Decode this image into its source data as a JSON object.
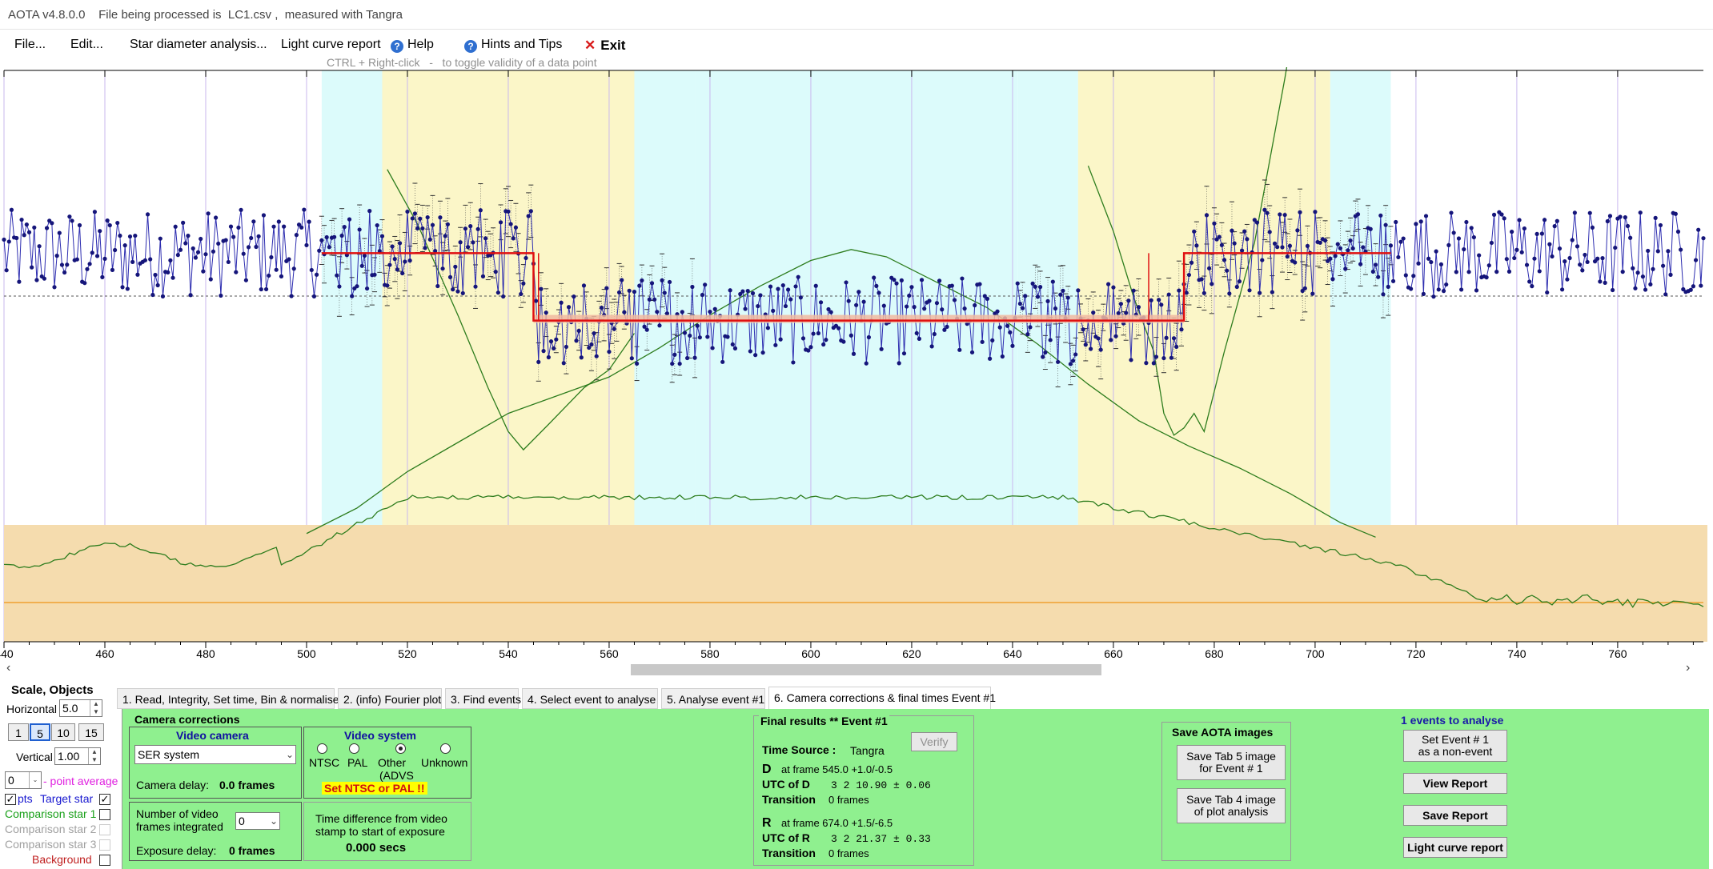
{
  "window": {
    "title": "AOTA v4.8.0.0    File being processed is  LC1.csv ,  measured with Tangra"
  },
  "menu": {
    "file": "File...",
    "edit": "Edit...",
    "star_diameter": "Star diameter analysis...",
    "light_curve_report": "Light curve report",
    "help": "Help",
    "hints": "Hints and Tips",
    "exit": "Exit"
  },
  "hint": "CTRL + Right-click   -   to toggle validity of a data point",
  "chart_data": {
    "type": "scatter",
    "x_ticks": [
      "440",
      "460",
      "480",
      "500",
      "520",
      "540",
      "560",
      "580",
      "600",
      "620",
      "640",
      "660",
      "680",
      "700",
      "720",
      "740",
      "760"
    ],
    "xlim": [
      440,
      777
    ],
    "ylim": [
      0,
      1
    ],
    "baseline_level": 0.72,
    "event_level": 0.535,
    "event_d_frame": 545.0,
    "event_r_frame": 674.0,
    "shaded_regions": [
      {
        "from": 503,
        "to": 515,
        "color": "#dcfbfb"
      },
      {
        "from": 515,
        "to": 565,
        "color": "#fbf6c8"
      },
      {
        "from": 565,
        "to": 577,
        "color": "#dcfbfb"
      },
      {
        "from": 577,
        "to": 641,
        "color": "#dcfbfb"
      },
      {
        "from": 641,
        "to": 653,
        "color": "#dcfbfb"
      },
      {
        "from": 653,
        "to": 703,
        "color": "#fbf6c8"
      },
      {
        "from": 703,
        "to": 715,
        "color": "#dcfbfb"
      }
    ],
    "comparison_band_color": "#f5dcae",
    "colors": {
      "data": "#15157a",
      "model": "#e01010",
      "green": "#2e7d1e",
      "orange": "#f0a030"
    }
  },
  "scale": {
    "title": "Scale,  Objects",
    "horizontal_label": "Horizontal",
    "horizontal_value": "5.0",
    "buttons": [
      "1",
      "5",
      "10",
      "15"
    ],
    "vertical_label": "Vertical",
    "vertical_value": "1.00",
    "avg_value": "0",
    "avg_label": "- point average",
    "pts_label": "pts",
    "target_label": "Target star",
    "comp1": "Comparison star 1",
    "comp2": "Comparison star 2",
    "comp3": "Comparison star 3",
    "background": "Background"
  },
  "tabs": [
    "1.  Read, Integrity, Set time, Bin & normalise",
    "2. (info) Fourier plot",
    "3. Find events",
    "4. Select event to analyse",
    "5. Analyse event #1",
    "6. Camera corrections & final times Event #1"
  ],
  "camera": {
    "title": "Camera corrections",
    "video_camera": "Video camera",
    "camera_select": "SER system",
    "camera_delay_label": "Camera delay:",
    "camera_delay_value": "0.0 frames",
    "video_system": "Video system",
    "ntsc": "NTSC",
    "pal": "PAL",
    "other": "Other",
    "advs": "(ADVS",
    "unknown": "Unknown",
    "warning": "Set NTSC or PAL !!",
    "frames_label_1": "Number of video",
    "frames_label_2": "frames integrated",
    "frames_value": "0",
    "exposure_label": "Exposure delay:",
    "exposure_value": "0 frames",
    "time_diff_1": "Time difference from video",
    "time_diff_2": "stamp to start of exposure",
    "time_diff_value": "0.000 secs"
  },
  "final": {
    "title": "Final results  **  Event #1",
    "verify": "Verify",
    "ts_label": "Time Source :",
    "ts_value": "Tangra",
    "d_label": "D",
    "d_frame": "at frame 545.0  +1.0/-0.5",
    "utc_d_label": "UTC of D",
    "utc_d_value": "3  2 10.90 ± 0.06",
    "trans_label": "Transition",
    "trans_d": "0 frames",
    "r_label": "R",
    "r_frame": "at frame 674.0  +1.5/-6.5",
    "utc_r_label": "UTC of R",
    "utc_r_value": "3  2 21.37 ± 0.33",
    "trans_r": "0 frames"
  },
  "save": {
    "title": "Save AOTA images",
    "tab5_1": "Save Tab 5 image",
    "tab5_2": "for Event # 1",
    "tab4_1": "Save Tab 4 image",
    "tab4_2": "of plot analysis"
  },
  "events": {
    "title": "1 events to analyse",
    "set_1": "Set Event # 1",
    "set_2": "as a non-event",
    "view": "View Report",
    "save": "Save Report",
    "lcr": "Light curve report"
  }
}
